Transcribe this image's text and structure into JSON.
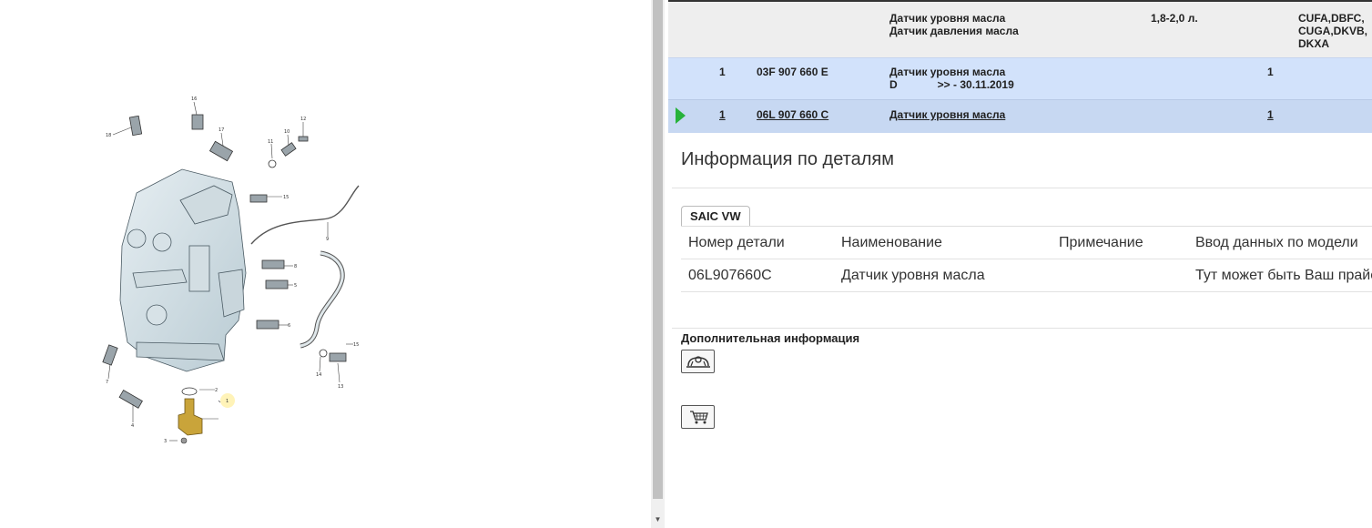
{
  "parts": {
    "rows": [
      {
        "qty": "",
        "number": "",
        "name1": "Датчик уровня масла",
        "name2": "Датчик давления масла",
        "volume": "1,8-2,0 л.",
        "count": "",
        "codes1": "CUFA,DBFC,",
        "codes2": "CUGA,DKVB,",
        "codes3": "DKXA"
      },
      {
        "qty": "1",
        "number": "03F 907 660 E",
        "name1": "Датчик уровня масла",
        "name2_prefix": "D",
        "name2": ">> - 30.11.2019",
        "volume": "",
        "count": "1"
      },
      {
        "qty": "1",
        "number": "06L 907 660 C",
        "name1": "Датчик уровня масла",
        "count": "1"
      }
    ]
  },
  "info": {
    "title": "Информация по деталям",
    "tab": "SAIC VW",
    "headers": [
      "Номер детали",
      "Наименование",
      "Примечание",
      "Ввод данных по модели"
    ],
    "row": [
      "06L907660C",
      "Датчик уровня масла",
      "",
      "Тут может быть Ваш прайс"
    ]
  },
  "additional": {
    "title": "Дополнительная информация",
    "buttons": [
      "dealer-icon",
      "cart-icon"
    ]
  },
  "diagram": {
    "callouts": [
      "16",
      "18",
      "17",
      "11",
      "10",
      "12",
      "15",
      "9",
      "8",
      "5",
      "6",
      "7",
      "4",
      "1",
      "3",
      "2",
      "14",
      "13"
    ],
    "highlight_color": "#fff3b8"
  }
}
